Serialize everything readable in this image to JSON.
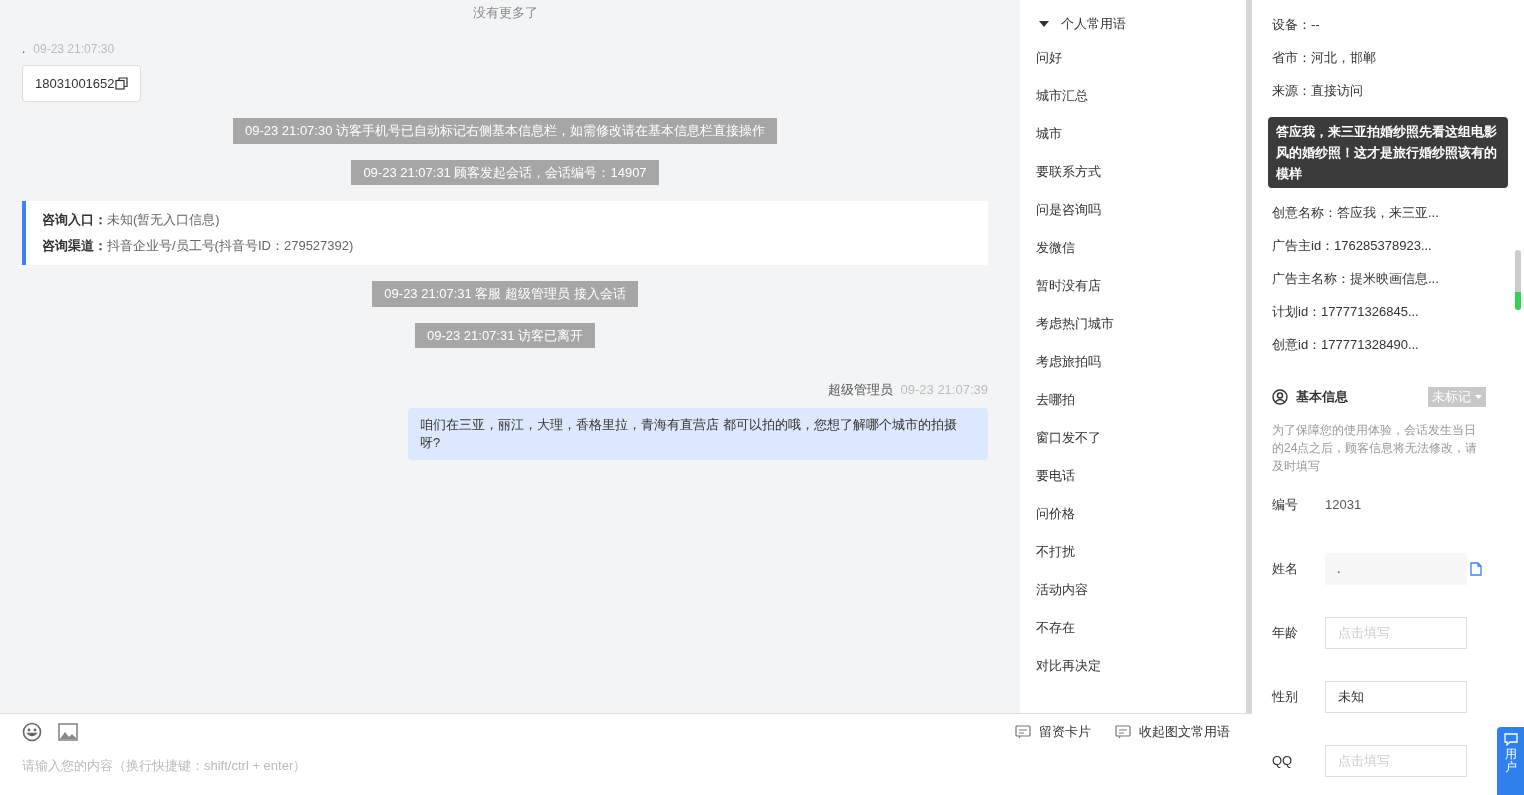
{
  "chat": {
    "no_more": "没有更多了",
    "messages": [
      {
        "kind": "visitor",
        "name": ".",
        "time": "09-23 21:07:30",
        "text": "18031001652"
      },
      {
        "kind": "system",
        "text": "09-23 21:07:30 访客手机号已自动标记右侧基本信息栏，如需修改请在基本信息栏直接操作"
      },
      {
        "kind": "system",
        "text": "09-23 21:07:31 顾客发起会话，会话编号：14907"
      },
      {
        "kind": "info",
        "rows": [
          {
            "label": "咨询入口：",
            "value": "未知(暂无入口信息)"
          },
          {
            "label": "咨询渠道：",
            "value": "抖音企业号/员工号(抖音号ID：279527392)"
          }
        ]
      },
      {
        "kind": "system",
        "text": "09-23 21:07:31 客服 超级管理员 接入会话"
      },
      {
        "kind": "system",
        "text": "09-23 21:07:31 访客已离开"
      },
      {
        "kind": "agent",
        "name": "超级管理员",
        "time": "09-23 21:07:39",
        "text": "咱们在三亚，丽江，大理，香格里拉，青海有直营店 都可以拍的哦，您想了解哪个城市的拍摄呀?"
      }
    ]
  },
  "composer": {
    "placeholder": "请输入您的内容（换行快捷键：shift/ctrl + enter）",
    "buttons": [
      "留资卡片",
      "收起图文常用语"
    ]
  },
  "phrases": {
    "title": "个人常用语",
    "expanded": true,
    "items": [
      "问好",
      "城市汇总",
      "城市",
      "要联系方式",
      "问是咨询吗",
      "发微信",
      "暂时没有店",
      "考虑热门城市",
      "考虑旅拍吗",
      "去哪拍",
      "窗口发不了",
      "要电话",
      "问价格",
      "不打扰",
      "活动内容",
      "不存在",
      "对比再决定"
    ]
  },
  "details": {
    "rows_before": [
      "设备：--",
      "省市：河北，邯郸",
      "来源：直接访问"
    ],
    "tooltip": "答应我，来三亚拍婚纱照先看这组电影风的婚纱照！这才是旅行婚纱照该有的模样",
    "rows_after": [
      "创意名称：答应我，来三亚...",
      "广告主id：176285378923...",
      "广告主名称：提米映画信息...",
      "计划id：177771326845...",
      "创意id：177771328490..."
    ]
  },
  "basic_info": {
    "title": "基本信息",
    "tag": "未标记",
    "note": "为了保障您的使用体验，会话发生当日的24点之后，顾客信息将无法修改，请及时填写",
    "fields": [
      {
        "kind": "text",
        "label": "编号",
        "value": "12031"
      },
      {
        "kind": "readonly",
        "label": "姓名",
        "value": "."
      },
      {
        "kind": "input",
        "label": "年龄",
        "placeholder": "点击填写"
      },
      {
        "kind": "input",
        "label": "性别",
        "value": "未知"
      },
      {
        "kind": "input",
        "label": "QQ",
        "placeholder": "点击填写"
      }
    ]
  },
  "side_tab": "用户"
}
